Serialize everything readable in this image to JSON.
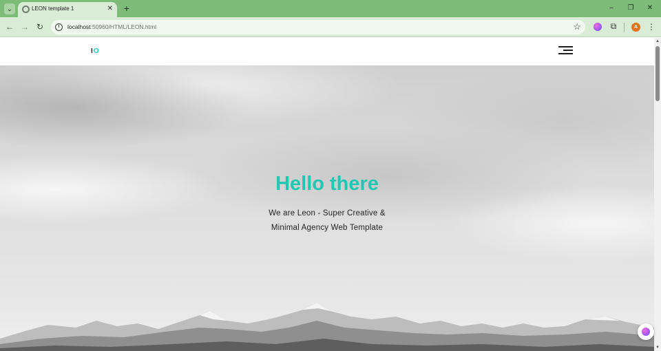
{
  "browser": {
    "tab_menu_icon": "chevron-down-icon",
    "tab_title": "LEON template 1",
    "tab_close": "✕",
    "new_tab": "+",
    "window_controls": {
      "minimize": "–",
      "restore": "❐",
      "close": "✕"
    },
    "nav": {
      "back": "←",
      "forward": "→",
      "reload": "↻"
    },
    "url_host": "localhost",
    "url_path": ":50960/HTML/LEON.html",
    "bookmark_icon": "☆",
    "extensions_icon": "⧉",
    "profile_initial": "A",
    "menu_icon": "⋮",
    "colors": {
      "frame": "#7dbb79",
      "toolbar": "#d9ecd5",
      "avatar": "#e8711d"
    }
  },
  "site": {
    "logo_i": "I",
    "logo_o": "O",
    "hero_title": "Hello there",
    "hero_sub_line1": "We are Leon - Super Creative &",
    "hero_sub_line2": "Minimal Agency Web Template",
    "colors": {
      "accent": "#20c7b3"
    }
  }
}
